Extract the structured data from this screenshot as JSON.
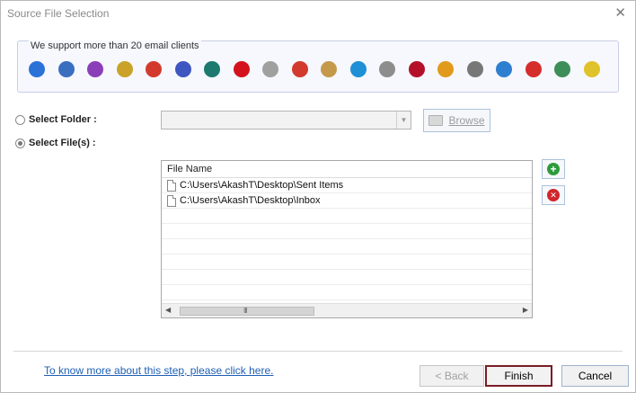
{
  "window": {
    "title": "Source File Selection",
    "close_glyph": "✕"
  },
  "clients": {
    "legend": "We support more than 20 email clients",
    "icons": [
      {
        "name": "mail-icon",
        "color": "#2a72d8"
      },
      {
        "name": "thunderbird-icon",
        "color": "#3a6fc0"
      },
      {
        "name": "eudora-icon",
        "color": "#8a3fb8"
      },
      {
        "name": "pegasus-icon",
        "color": "#c9a227"
      },
      {
        "name": "gmail-icon",
        "color": "#d23a2e"
      },
      {
        "name": "postbox-icon",
        "color": "#3e56c0"
      },
      {
        "name": "netscape-icon",
        "color": "#1c7a6e"
      },
      {
        "name": "opera-icon",
        "color": "#d4121e"
      },
      {
        "name": "clock-mail-icon",
        "color": "#a0a0a0"
      },
      {
        "name": "arrow-mail-icon",
        "color": "#d23a2e"
      },
      {
        "name": "mailbird-icon",
        "color": "#c49a4a"
      },
      {
        "name": "outlook-icon",
        "color": "#1f8fd6"
      },
      {
        "name": "lotus-icon",
        "color": "#8d8d8d"
      },
      {
        "name": "berry-mail-icon",
        "color": "#b4102a"
      },
      {
        "name": "gmx-icon",
        "color": "#e29a1b"
      },
      {
        "name": "gnu-icon",
        "color": "#777777"
      },
      {
        "name": "send-icon",
        "color": "#2f7fd0"
      },
      {
        "name": "envelope-red-icon",
        "color": "#d52c2c"
      },
      {
        "name": "seamonkey-icon",
        "color": "#3e8e5a"
      },
      {
        "name": "bat-icon",
        "color": "#e0c22a"
      }
    ]
  },
  "source": {
    "folder_label": "Select Folder :",
    "files_label": "Select File(s) :",
    "folder_value": "",
    "browse_label": "Browse"
  },
  "files": {
    "header": "File Name",
    "rows": [
      "C:\\Users\\AkashT\\Desktop\\Sent Items",
      "C:\\Users\\AkashT\\Desktop\\Inbox"
    ],
    "scroll_grip": "III",
    "scroll_left": "◀",
    "scroll_right": "▶"
  },
  "side_buttons": {
    "add_glyph": "+",
    "remove_glyph": "✕"
  },
  "footer": {
    "help_link": "To know more about this step, please click here.",
    "back_label": "< Back",
    "finish_label": "Finish",
    "cancel_label": "Cancel"
  }
}
